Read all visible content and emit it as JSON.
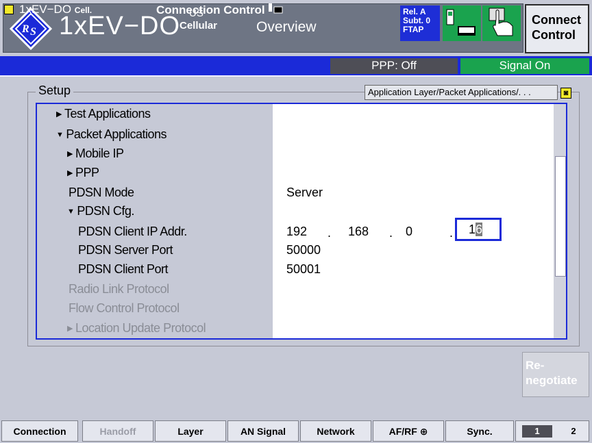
{
  "header": {
    "system": "1xEV−DO",
    "band_line1": "US",
    "band_line2": "Cellular",
    "mode": "Overview",
    "release_badge": [
      "Rel. A",
      "Subt. 0",
      "FTAP"
    ],
    "connect_control": [
      "Connect",
      "Control"
    ]
  },
  "status": {
    "system": "1xEV−DO",
    "system_suffix": "Cell.",
    "connection": "Connection Control",
    "ppp": "PPP: Off",
    "signal": "Signal On"
  },
  "setup": {
    "label": "Setup",
    "path": "Application Layer/Packet Applications/. . .",
    "rows": [
      {
        "label": "Test Applications",
        "arrow": "▶",
        "dim": false
      },
      {
        "label": "Packet Applications",
        "arrow": "▼",
        "dim": false
      },
      {
        "label": "Mobile IP",
        "arrow": "▶",
        "dim": false
      },
      {
        "label": "PPP",
        "arrow": "▶",
        "dim": false
      },
      {
        "label": "PDSN Mode",
        "arrow": "",
        "dim": false
      },
      {
        "label": "PDSN Cfg.",
        "arrow": "▼",
        "dim": false
      },
      {
        "label": "PDSN Client IP Addr.",
        "arrow": "",
        "dim": false
      },
      {
        "label": "PDSN Server Port",
        "arrow": "",
        "dim": false
      },
      {
        "label": "PDSN Client Port",
        "arrow": "",
        "dim": false
      },
      {
        "label": "Radio Link Protocol",
        "arrow": "",
        "dim": true
      },
      {
        "label": "Flow Control Protocol",
        "arrow": "",
        "dim": true
      },
      {
        "label": "Location Update Protocol",
        "arrow": "▶",
        "dim": true
      }
    ],
    "values": {
      "pdsn_mode": "Server",
      "ip": [
        "192",
        "168",
        "0",
        "16"
      ],
      "ip_sep": ".",
      "server_port": "50000",
      "client_port": "50001"
    }
  },
  "renegotiate": [
    "Re-",
    "negotiate"
  ],
  "tabs": [
    {
      "label": "Connection",
      "disabled": false
    },
    {
      "label": "Handoff",
      "disabled": true
    },
    {
      "label": "Layer",
      "disabled": false
    },
    {
      "label": "AN Signal",
      "disabled": false
    },
    {
      "label": "Network",
      "disabled": false
    },
    {
      "label": "AF/RF",
      "disabled": false
    },
    {
      "label": "Sync.",
      "disabled": false
    }
  ],
  "pages": [
    "1",
    "2"
  ],
  "colors": {
    "accent_blue": "#1b2ad8",
    "signal_green": "#1aa34e",
    "ppp_gray": "#4e4e56"
  }
}
